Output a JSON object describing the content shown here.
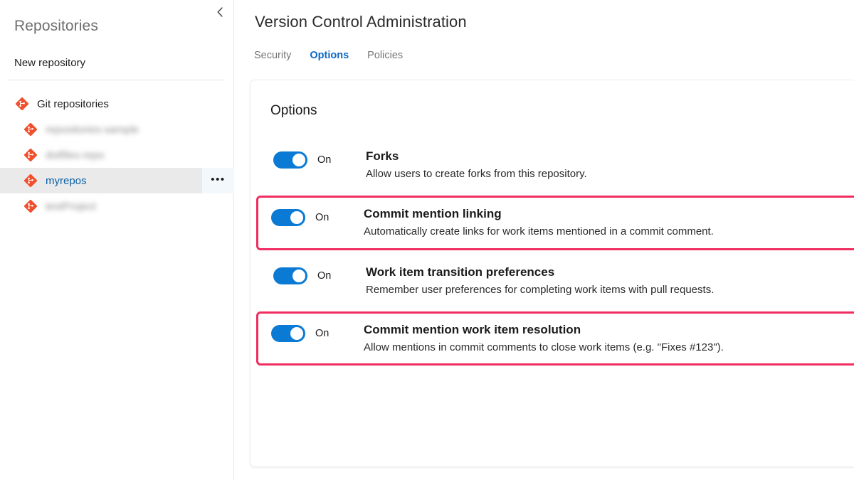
{
  "sidebar": {
    "title": "Repositories",
    "new_repository_label": "New repository",
    "collapse_icon": "chevron-left-icon",
    "tree": {
      "root_label": "Git repositories",
      "items": [
        {
          "label": "repositories-sample",
          "redacted": true,
          "selected": false
        },
        {
          "label": "dotfiles-repo",
          "redacted": true,
          "selected": false
        },
        {
          "label": "myrepos",
          "redacted": false,
          "selected": true
        },
        {
          "label": "testProject",
          "redacted": true,
          "selected": false
        }
      ],
      "row_menu_label": "•••"
    }
  },
  "main": {
    "page_title": "Version Control Administration",
    "tabs": [
      {
        "label": "Security",
        "active": false
      },
      {
        "label": "Options",
        "active": true
      },
      {
        "label": "Policies",
        "active": false
      }
    ],
    "card": {
      "title": "Options",
      "options": [
        {
          "state_label": "On",
          "enabled": true,
          "name": "Forks",
          "description": "Allow users to create forks from this repository.",
          "highlighted": false
        },
        {
          "state_label": "On",
          "enabled": true,
          "name": "Commit mention linking",
          "description": "Automatically create links for work items mentioned in a commit comment.",
          "highlighted": true
        },
        {
          "state_label": "On",
          "enabled": true,
          "name": "Work item transition preferences",
          "description": "Remember user preferences for completing work items with pull requests.",
          "highlighted": false
        },
        {
          "state_label": "On",
          "enabled": true,
          "name": "Commit mention work item resolution",
          "description": "Allow mentions in commit comments to close work items (e.g. \"Fixes #123\").",
          "highlighted": true
        }
      ]
    }
  },
  "colors": {
    "accent_blue": "#0b7ad4",
    "tab_active": "#0b69c7",
    "highlight_pink": "#f02d60",
    "git_orange": "#f0502e",
    "selected_row_bg": "#eaeaea"
  }
}
